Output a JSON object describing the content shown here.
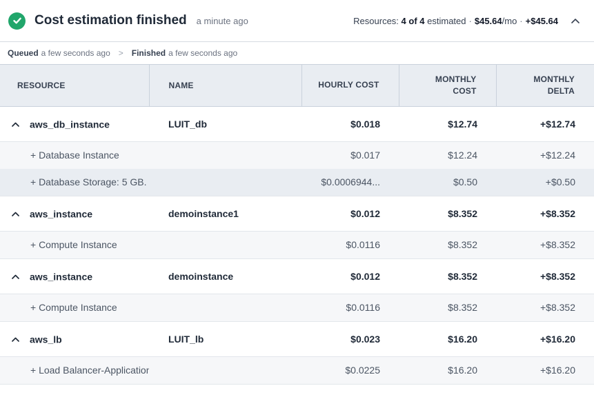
{
  "header": {
    "title": "Cost estimation finished",
    "time_ago": "a minute ago",
    "resources_label": "Resources:",
    "resources_count": "4 of 4",
    "estimated_label": "estimated",
    "sep": "·",
    "monthly_cost": "$45.64",
    "per_mo": "/mo",
    "delta": "+$45.64"
  },
  "timeline": {
    "queued_label": "Queued",
    "queued_time": "a few seconds ago",
    "arrow": ">",
    "finished_label": "Finished",
    "finished_time": "a few seconds ago"
  },
  "table": {
    "headers": {
      "resource": "RESOURCE",
      "name": "NAME",
      "hourly": "HOURLY COST",
      "monthly_1": "MONTHLY",
      "monthly_2": "COST",
      "delta_1": "MONTHLY",
      "delta_2": "DELTA"
    },
    "resources": [
      {
        "type": "aws_db_instance",
        "name": "LUIT_db",
        "hourly": "$0.018",
        "monthly": "$12.74",
        "delta": "+$12.74",
        "items": [
          {
            "label": "+ Database Instance",
            "hourly": "$0.017",
            "monthly": "$12.24",
            "delta": "+$12.24"
          },
          {
            "label": "+ Database Storage: 5 GB.",
            "hourly": "$0.0006944...",
            "monthly": "$0.50",
            "delta": "+$0.50"
          }
        ]
      },
      {
        "type": "aws_instance",
        "name": "demoinstance1",
        "hourly": "$0.012",
        "monthly": "$8.352",
        "delta": "+$8.352",
        "items": [
          {
            "label": "+ Compute Instance",
            "hourly": "$0.0116",
            "monthly": "$8.352",
            "delta": "+$8.352"
          }
        ]
      },
      {
        "type": "aws_instance",
        "name": "demoinstance",
        "hourly": "$0.012",
        "monthly": "$8.352",
        "delta": "+$8.352",
        "items": [
          {
            "label": "+ Compute Instance",
            "hourly": "$0.0116",
            "monthly": "$8.352",
            "delta": "+$8.352"
          }
        ]
      },
      {
        "type": "aws_lb",
        "name": "LUIT_lb",
        "hourly": "$0.023",
        "monthly": "$16.20",
        "delta": "+$16.20",
        "items": [
          {
            "label": "+ Load Balancer-Application",
            "hourly": "$0.0225",
            "monthly": "$16.20",
            "delta": "+$16.20"
          }
        ]
      }
    ]
  },
  "colors": {
    "success": "#21a66b",
    "header_bg": "#e9edf2",
    "sub_row_bg": "#f6f7f9"
  },
  "icons": {
    "status": "check-circle-icon",
    "collapse": "chevron-up-icon"
  }
}
